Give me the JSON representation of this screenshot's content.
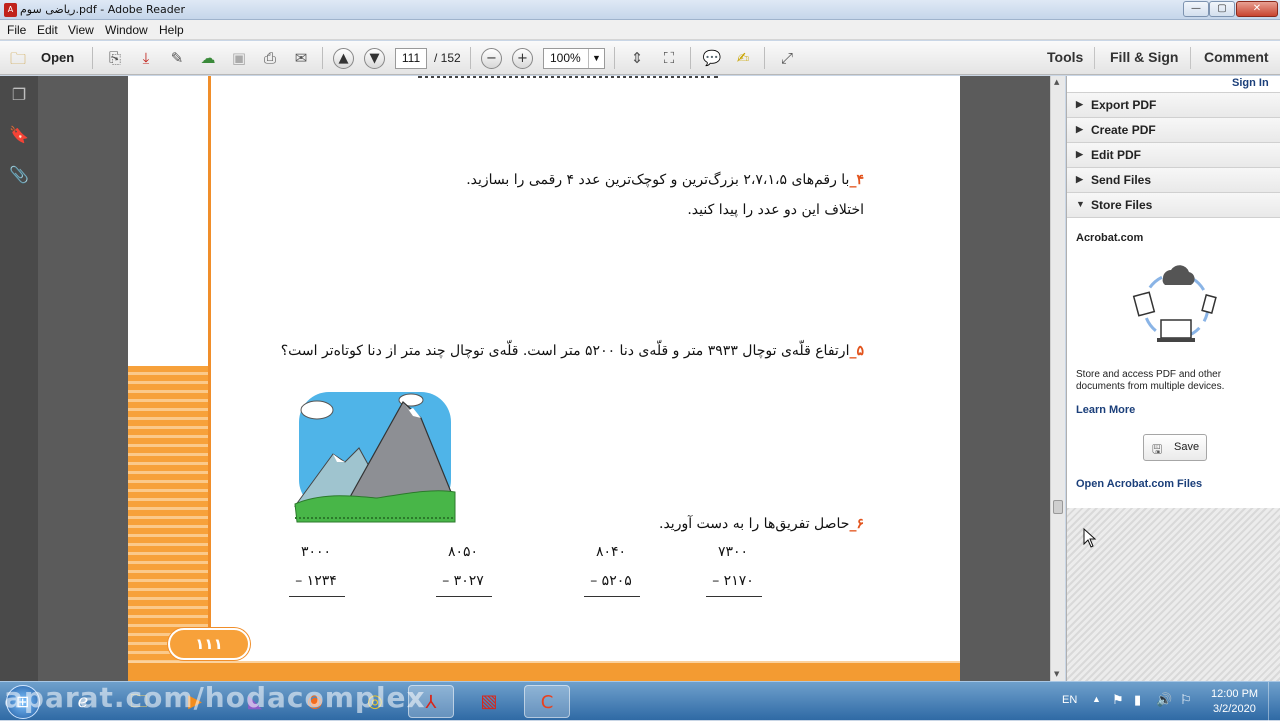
{
  "window": {
    "title": "ریاضی سوم.pdf - Adobe Reader",
    "minimize": "—",
    "maximize": "▢",
    "close": "✕"
  },
  "menu": [
    "File",
    "Edit",
    "View",
    "Window",
    "Help"
  ],
  "toolbar": {
    "open_label": "Open",
    "page_current": "111",
    "page_total": "/ 152",
    "zoom": "100%",
    "tools_label": "Tools",
    "fill_sign_label": "Fill & Sign",
    "comment_label": "Comment"
  },
  "document": {
    "q4_num": "۴_",
    "q4_line1": "با رقم‌های ۲،۷،۱،۵ بزرگ‌ترین و کوچک‌ترین عدد ۴ رقمی را بسازید.",
    "q4_line2": "اختلاف این دو عدد را پیدا کنید.",
    "q5_num": "۵_",
    "q5_text": "ارتفاع قلّه‌ی توچال ۳۹۳۳ متر و قلّه‌ی دنا ۵۲۰۰ متر است. قلّه‌ی توچال چند متر از دنا کوتاه‌تر است؟",
    "q6_num": "۶_",
    "q6_text": "حاصل تفریق‌ها را به دست آورید.",
    "subtractions": [
      {
        "top": "۳۰۰۰",
        "bottom": "– ۱۲۳۴"
      },
      {
        "top": "۸۰۵۰",
        "bottom": "– ۳۰۲۷"
      },
      {
        "top": "۸۰۴۰",
        "bottom": "– ۵۲۰۵"
      },
      {
        "top": "۷۳۰۰",
        "bottom": "– ۲۱۷۰"
      }
    ],
    "page_number": "۱۱۱"
  },
  "rightpane": {
    "sign_in": "Sign In",
    "sections": [
      "Export PDF",
      "Create PDF",
      "Edit PDF",
      "Send Files",
      "Store Files"
    ],
    "acrobat_title": "Acrobat.com",
    "description": "Store and access PDF and other documents from multiple devices.",
    "learn_more": "Learn More",
    "save_label": "Save",
    "open_files": "Open Acrobat.com Files"
  },
  "taskbar": {
    "watermark": "aparat.com/hodacomplex",
    "lang": "EN",
    "time": "12:00 PM",
    "date": "3/2/2020"
  },
  "colors": {
    "accent_orange": "#f39b32",
    "question_number": "#e2531c",
    "link_blue": "#1b3f7a"
  }
}
